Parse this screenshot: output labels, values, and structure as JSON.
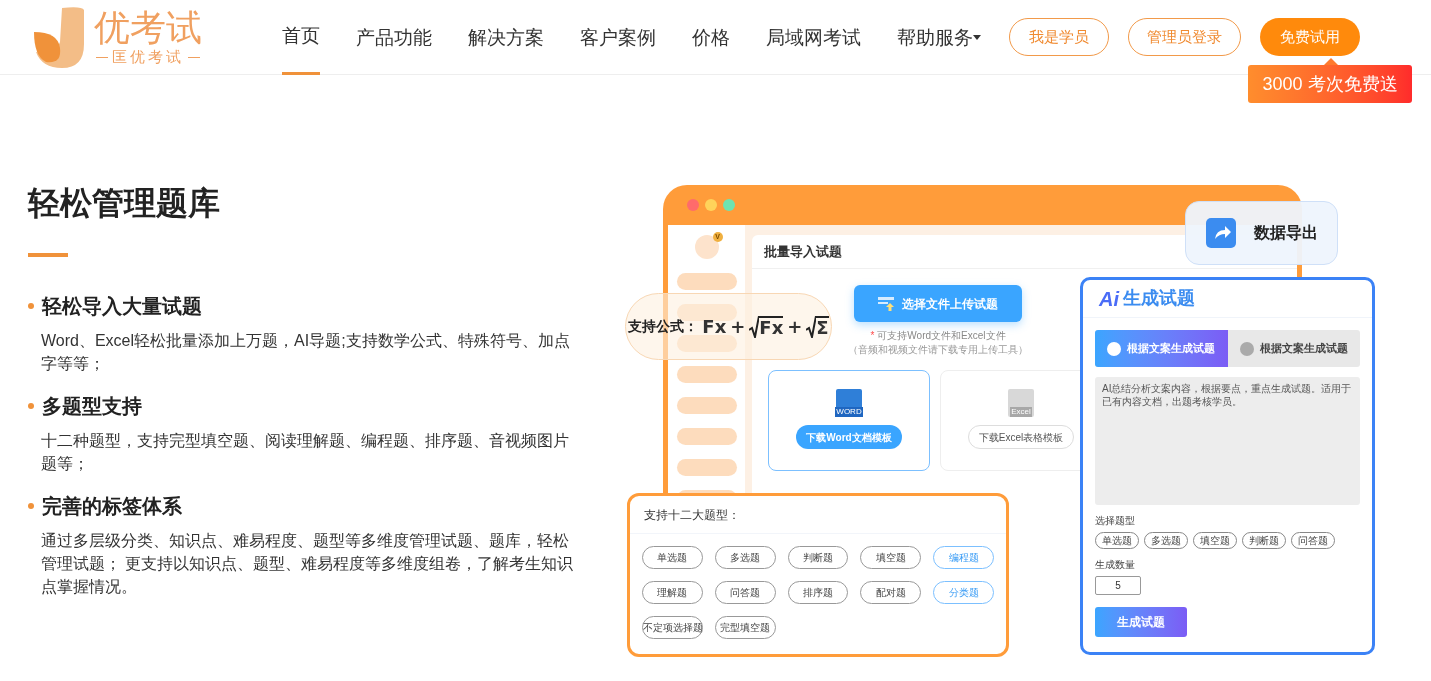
{
  "header": {
    "logo": {
      "name": "优考试",
      "tagline": "匡优考试"
    },
    "nav": [
      {
        "label": "首页",
        "selected": true,
        "dropdown": false
      },
      {
        "label": "产品功能",
        "selected": false,
        "dropdown": false
      },
      {
        "label": "解决方案",
        "selected": false,
        "dropdown": false
      },
      {
        "label": "客户案例",
        "selected": false,
        "dropdown": false
      },
      {
        "label": "价格",
        "selected": false,
        "dropdown": false
      },
      {
        "label": "局域网考试",
        "selected": false,
        "dropdown": false
      },
      {
        "label": "帮助服务",
        "selected": false,
        "dropdown": true
      }
    ],
    "buttons": [
      {
        "label": "我是学员",
        "kind": "outline"
      },
      {
        "label": "管理员登录",
        "kind": "outline"
      },
      {
        "label": "免费试用",
        "kind": "solid"
      }
    ],
    "promo": "3000 考次免费送"
  },
  "feature": {
    "title": "轻松管理题库",
    "items": [
      {
        "title": "轻松导入大量试题",
        "text": "Word、Excel轻松批量添加上万题，AI导题;支持数学公式、特殊符号、加点字等等；"
      },
      {
        "title": "多题型支持",
        "text": "十二种题型，支持完型填空题、阅读理解题、编程题、排序题、音视频图片题等；"
      },
      {
        "title": "完善的标签体系",
        "text": "通过多层级分类、知识点、难易程度、题型等多维度管理试题、题库，轻松管理试题； 更支持以知识点、题型、难易程度等多维度组卷，了解考生知识点掌握情况。"
      }
    ]
  },
  "illustration": {
    "import_window": {
      "avatar_badge": "V",
      "title": "批量导入试题",
      "upload_button": "选择文件上传试题",
      "required_mark": "*",
      "note": "可支持Word文件和Excel文件",
      "note_detail": "（音频和视频文件请下载专用上传工具）",
      "templates": [
        {
          "kind": "word",
          "file_label": "WORD",
          "button": "下载Word文档模板",
          "selected": true
        },
        {
          "kind": "excel",
          "file_label": "Excel",
          "button": "下载Excel表格模板",
          "selected": false
        }
      ]
    },
    "formula": {
      "label": "支持公式：",
      "terms": [
        {
          "text": "Fx",
          "sqrt": false
        },
        {
          "text": "+",
          "sqrt": false
        },
        {
          "text": "Fx",
          "sqrt": true
        },
        {
          "text": "+",
          "sqrt": false
        },
        {
          "text": "Σ",
          "sqrt": true
        }
      ]
    },
    "export_card": {
      "label": "数据导出"
    },
    "ai_panel": {
      "logo": "Ai",
      "title": "生成试题",
      "tabs": [
        {
          "label": "根据文案生成试题",
          "selected": true
        },
        {
          "label": "根据文案生成试题",
          "selected": false
        }
      ],
      "text": "AI总结分析文案内容，根据要点，重点生成试题。适用于已有内容文档，出题考核学员。",
      "type_label": "选择题型",
      "types": [
        "单选题",
        "多选题",
        "填空题",
        "判断题",
        "问答题"
      ],
      "count_label": "生成数量",
      "count": "5",
      "generate_button": "生成试题"
    },
    "types_panel": {
      "title": "支持十二大题型：",
      "types": [
        {
          "label": "单选题",
          "highlighted": false
        },
        {
          "label": "多选题",
          "highlighted": false
        },
        {
          "label": "判断题",
          "highlighted": false
        },
        {
          "label": "填空题",
          "highlighted": false
        },
        {
          "label": "编程题",
          "highlighted": true
        },
        {
          "label": "理解题",
          "highlighted": false
        },
        {
          "label": "问答题",
          "highlighted": false
        },
        {
          "label": "排序题",
          "highlighted": false
        },
        {
          "label": "配对题",
          "highlighted": false
        },
        {
          "label": "分类题",
          "highlighted": true
        },
        {
          "label": "不定项选择题",
          "highlighted": false
        },
        {
          "label": "完型填空题",
          "highlighted": false
        }
      ]
    }
  }
}
